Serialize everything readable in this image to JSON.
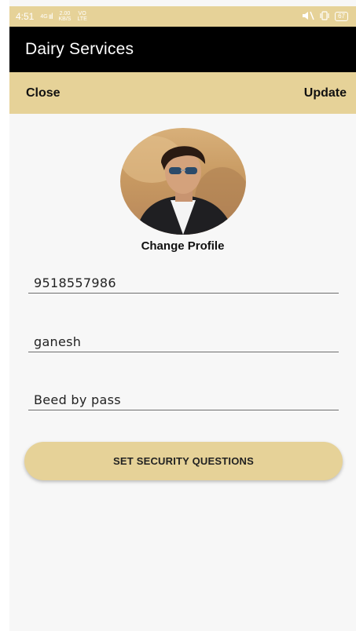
{
  "status_bar": {
    "time": "4:51",
    "signal_top": "4G",
    "signal_label": "ııl",
    "net_speed_top": "2.00",
    "net_speed_bottom": "KB/S",
    "volte_top": "VO",
    "volte_bottom": "LTE",
    "battery": "67"
  },
  "app_bar": {
    "title": "Dairy Services"
  },
  "action_bar": {
    "close_label": "Close",
    "update_label": "Update"
  },
  "profile": {
    "change_label": "Change Profile"
  },
  "form": {
    "phone": "9518557986",
    "name": "ganesh",
    "address": "Beed by pass"
  },
  "security_button": {
    "label": "SET SECURITY QUESTIONS"
  },
  "colors": {
    "accent": "#e6d298",
    "app_bar": "#000000",
    "background": "#f7f7f7"
  }
}
